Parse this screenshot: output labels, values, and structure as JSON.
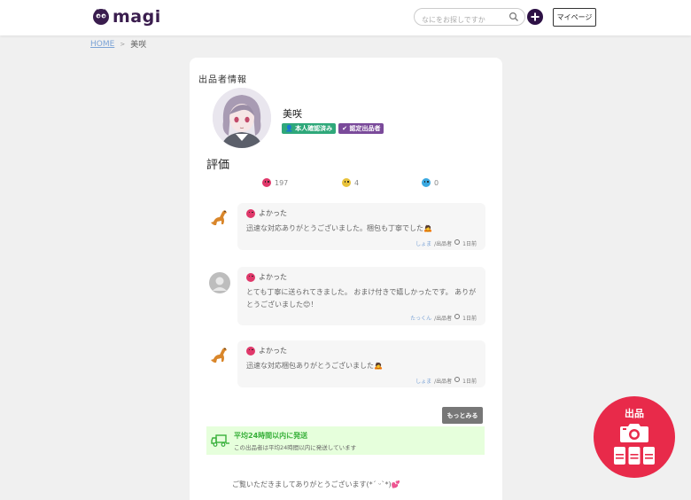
{
  "header": {
    "logo_text": "magi",
    "search_placeholder": "なにをお探しですか",
    "mypage_label": "マイページ"
  },
  "breadcrumb": {
    "home": "HOME",
    "separator": ">",
    "current": "美咲"
  },
  "seller": {
    "section_title": "出品者情報",
    "name": "美咲",
    "badges": [
      "本人確認済み",
      "認定出品者"
    ]
  },
  "rating": {
    "title": "評価",
    "good": "197",
    "normal": "4",
    "bad": "0"
  },
  "reviews": [
    {
      "label": "よかった",
      "text": "迅速な対応ありがとうございました。梱包も丁寧でした🙇",
      "reviewer": "しょま",
      "role": "/出品者",
      "time": "1日前",
      "avatar": "dinosaur-icon"
    },
    {
      "label": "よかった",
      "text": "とても丁寧に送られてきました。 おまけ付きで嬉しかったです。 ありがとうございました😊！",
      "reviewer": "たっくん",
      "role": "/出品者",
      "time": "1日前",
      "avatar": "default-user-icon"
    },
    {
      "label": "よかった",
      "text": "迅速な対応梱包ありがとうございました🙇",
      "reviewer": "しょま",
      "role": "/出品者",
      "time": "1日前",
      "avatar": "dinosaur-icon"
    }
  ],
  "more_label": "もっとみる",
  "shipping": {
    "title": "平均24時間以内に発送",
    "subtitle": "この出品者は平均24時間以内に発送しています"
  },
  "greeting": "ご覧いただきましてありがとうございます(*´ ᵕ`*)💕",
  "fab": {
    "label": "出品"
  },
  "colors": {
    "brand": "#2d1145",
    "fab": "#e82a4a",
    "good": "#e0386a",
    "normal": "#e8c23a",
    "bad": "#3aa8e0",
    "shipping_green": "#38b03a"
  }
}
